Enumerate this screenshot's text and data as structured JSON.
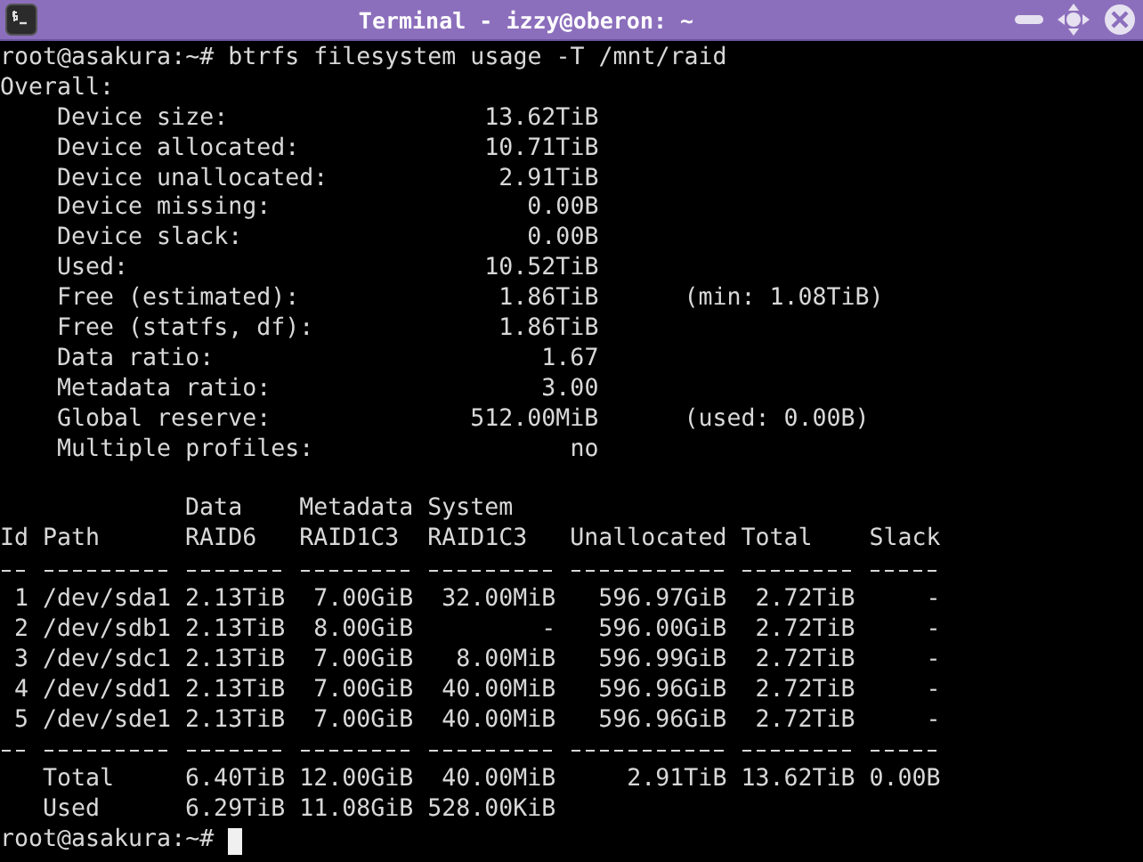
{
  "window": {
    "title": "Terminal - izzy@oberon: ~"
  },
  "command": {
    "prompt": "root@asakura:~#",
    "text": "btrfs filesystem usage -T /mnt/raid"
  },
  "overall": {
    "heading": "Overall:",
    "items": [
      {
        "label": "Device size:",
        "value": "13.62TiB"
      },
      {
        "label": "Device allocated:",
        "value": "10.71TiB"
      },
      {
        "label": "Device unallocated:",
        "value": "2.91TiB"
      },
      {
        "label": "Device missing:",
        "value": "0.00B"
      },
      {
        "label": "Device slack:",
        "value": "0.00B"
      },
      {
        "label": "Used:",
        "value": "10.52TiB"
      },
      {
        "label": "Free (estimated):",
        "value": "1.86TiB",
        "note": "(min: 1.08TiB)"
      },
      {
        "label": "Free (statfs, df):",
        "value": "1.86TiB"
      },
      {
        "label": "Data ratio:",
        "value": "1.67"
      },
      {
        "label": "Metadata ratio:",
        "value": "3.00"
      },
      {
        "label": "Global reserve:",
        "value": "512.00MiB",
        "note": "(used: 0.00B)"
      },
      {
        "label": "Multiple profiles:",
        "value": "no"
      }
    ]
  },
  "table": {
    "columns": [
      {
        "label": "Id"
      },
      {
        "label": "Path"
      },
      {
        "group": "Data",
        "label": "RAID6"
      },
      {
        "group": "Metadata",
        "label": "RAID1C3"
      },
      {
        "group": "System",
        "label": "RAID1C3"
      },
      {
        "label": "Unallocated"
      },
      {
        "label": "Total"
      },
      {
        "label": "Slack"
      }
    ],
    "rows": [
      [
        "1",
        "/dev/sda1",
        "2.13TiB",
        "7.00GiB",
        "32.00MiB",
        "596.97GiB",
        "2.72TiB",
        "-"
      ],
      [
        "2",
        "/dev/sdb1",
        "2.13TiB",
        "8.00GiB",
        "-",
        "596.00GiB",
        "2.72TiB",
        "-"
      ],
      [
        "3",
        "/dev/sdc1",
        "2.13TiB",
        "7.00GiB",
        "8.00MiB",
        "596.99GiB",
        "2.72TiB",
        "-"
      ],
      [
        "4",
        "/dev/sdd1",
        "2.13TiB",
        "7.00GiB",
        "40.00MiB",
        "596.96GiB",
        "2.72TiB",
        "-"
      ],
      [
        "5",
        "/dev/sde1",
        "2.13TiB",
        "7.00GiB",
        "40.00MiB",
        "596.96GiB",
        "2.72TiB",
        "-"
      ]
    ],
    "summary": [
      {
        "label": "Total",
        "values": [
          "6.40TiB",
          "12.00GiB",
          "40.00MiB",
          "2.91TiB",
          "13.62TiB",
          "0.00B"
        ]
      },
      {
        "label": "Used",
        "values": [
          "6.29TiB",
          "11.08GiB",
          "528.00KiB"
        ]
      }
    ]
  },
  "final_prompt": {
    "prompt": "root@asakura:~#",
    "cursor_visible": true
  }
}
